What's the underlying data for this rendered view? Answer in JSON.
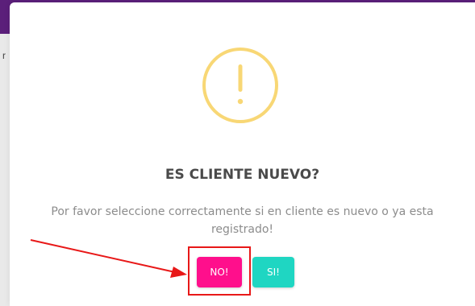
{
  "dialog": {
    "icon": "exclamation-icon",
    "title": "ES CLIENTE NUEVO?",
    "message": "Por favor seleccione correctamente si en cliente es nuevo o ya esta registrado!",
    "buttons": {
      "no_label": "NO!",
      "si_label": "SI!"
    }
  },
  "colors": {
    "header_bar": "#5b1f7a",
    "warning_icon": "#f8d775",
    "no_button": "#ff0f8c",
    "si_button": "#1fd6c2",
    "annotation": "#e81818"
  }
}
